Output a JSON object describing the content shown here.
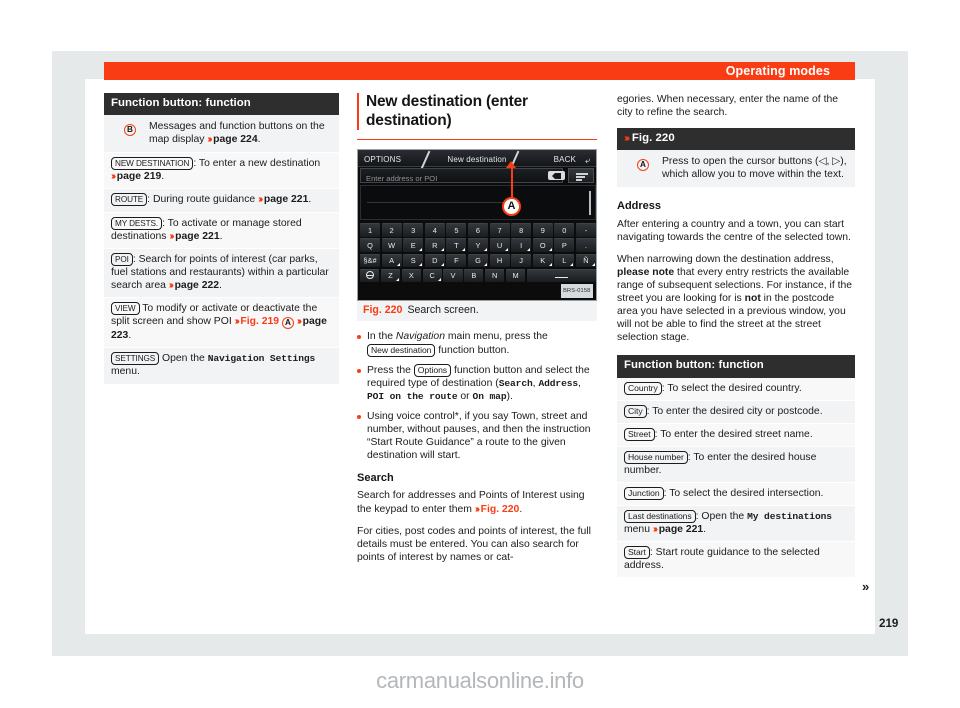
{
  "header": {
    "title": "Operating modes"
  },
  "folio": {
    "page_number": "219",
    "continuation": "»"
  },
  "watermark": {
    "text": "carmanualsonline.info"
  },
  "left_column": {
    "table_header": "Function button: function",
    "rows": [
      {
        "callout": "B",
        "text_a": "Messages and function buttons on the map display ",
        "arrow": "›››",
        "ref": "page 224",
        "text_b": "."
      },
      {
        "button": "NEW DESTINATION",
        "text_a": ": To enter a new destination ",
        "arrow": "›››",
        "ref": "page 219",
        "text_b": "."
      },
      {
        "button": "ROUTE",
        "text_a": ": During route guidance ",
        "arrow": "›››",
        "ref": "page 221",
        "text_b": "."
      },
      {
        "button": "MY DESTS.",
        "text_a": ": To activate or manage stored destinations ",
        "arrow": "›››",
        "ref": "page 221",
        "text_b": "."
      },
      {
        "button": "POI",
        "text_a": ": Search for points of interest (car parks, fuel stations and restaurants) within a particular search area ",
        "arrow": "›››",
        "ref": "page 222",
        "text_b": "."
      },
      {
        "button": "VIEW",
        "text_a": " To modify or activate or deactivate the split screen and show POI ",
        "arrow": "›››",
        "fig_ref": "Fig. 219",
        "circle": "A",
        "arrow2": "›››",
        "ref": "page 223",
        "text_b": "."
      },
      {
        "button": "SETTINGS",
        "text_a": " Open the ",
        "mono": "Navigation Settings",
        "text_b": " menu."
      }
    ]
  },
  "middle_column": {
    "section_title": "New destination (enter destination)",
    "figure": {
      "caption_number": "Fig. 220",
      "caption_text": "Search screen.",
      "code_label": "BRS-0158",
      "screen": {
        "top_left_label": "OPTIONS",
        "top_center_label": "New destination",
        "top_right_label": "BACK",
        "input_placeholder": "Enter address or POI",
        "callout": "A",
        "keyboard_rows": [
          [
            "1",
            "2",
            "3",
            "4",
            "5",
            "6",
            "7",
            "8",
            "9",
            "0",
            "-"
          ],
          [
            "Q",
            "W",
            "E",
            "R",
            "T",
            "Y",
            "U",
            "I",
            "O",
            "P",
            "."
          ],
          [
            "§&#",
            "A",
            "S",
            "D",
            "F",
            "G",
            "H",
            "J",
            "K",
            "L",
            "Ñ"
          ],
          [
            "globe-icon",
            "Z",
            "X",
            "C",
            "V",
            "B",
            "N",
            "M",
            "space-key"
          ]
        ]
      }
    },
    "bullets": [
      {
        "text_a": "In the ",
        "italic": "Navigation",
        "text_b": " main menu, press the ",
        "button": "New destination",
        "text_c": " function button."
      },
      {
        "text_a": "Press the ",
        "button": "Options",
        "text_b": " function button and select the required type of destination (",
        "mono1": "Search",
        "sep1": ", ",
        "mono2": "Address",
        "sep2": ", ",
        "mono3": "POI on the route",
        "sep3": " or ",
        "mono4": "On map",
        "text_c": ")."
      },
      {
        "text_a": "Using voice control*, if you say Town, street and number, without pauses, and then the instruction “Start Route Guidance” a route to the given destination will start."
      }
    ],
    "search_heading": "Search",
    "search_para_1_a": "Search for addresses and Points of Interest using the keypad to enter them ",
    "search_para_1_arrow": "›››",
    "search_para_1_ref": "Fig. 220",
    "search_para_1_b": ".",
    "search_para_2": "For cities, post codes and points of interest, the full details must be entered. You can also search for points of interest by names or cat-"
  },
  "right_column": {
    "intro_para": "egories. When necessary, enter the name of the city to refine the search.",
    "fig_table_header": {
      "arrow": "›››",
      "label": "Fig. 220"
    },
    "fig_table_row": {
      "callout": "A",
      "text": "Press to open the cursor buttons (◁, ▷), which allow you to move within the text."
    },
    "address_heading": "Address",
    "address_para_1": "After entering a country and a town, you can start navigating towards the centre of the selected town.",
    "address_para_2": {
      "text_a": "When narrowing down the destination address, ",
      "bold_a": "please note",
      "text_b": " that every entry restricts the available range of subsequent selections. For instance, if the street you are looking for is ",
      "bold_b": "not",
      "text_c": " in the postcode area you have selected in a previous window, you will not be able to find the street at the street selection stage."
    },
    "table_header": "Function button: function",
    "rows": [
      {
        "button": "Country",
        "text": ": To select the desired country."
      },
      {
        "button": "City",
        "text": ": To enter the desired city or postcode."
      },
      {
        "button": "Street",
        "text": ": To enter the desired street name."
      },
      {
        "button": "House number",
        "text": ": To enter the desired house number."
      },
      {
        "button": "Junction",
        "text": ": To select the desired intersection."
      },
      {
        "button": "Last destinations",
        "text_a": ": Open the ",
        "mono": "My destinations",
        "text_b": " menu ",
        "arrow": "›››",
        "ref": "page 221",
        "text_c": "."
      },
      {
        "button": "Start",
        "text": ": Start route guidance to the selected address."
      }
    ]
  },
  "colors": {
    "accent_red": "#fa3c15",
    "header_dark": "#2e2e2e",
    "row_grey": "#f2f3f4",
    "frame_grey": "#e6e9ea"
  }
}
